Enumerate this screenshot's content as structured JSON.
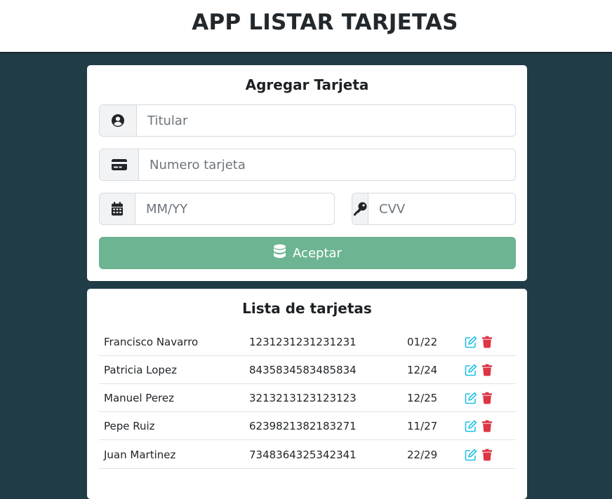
{
  "header": {
    "title": "APP LISTAR TARJETAS"
  },
  "form": {
    "title": "Agregar Tarjeta",
    "holder": {
      "placeholder": "Titular",
      "icon": "user-circle-icon"
    },
    "number": {
      "placeholder": "Numero tarjeta",
      "icon": "credit-card-icon"
    },
    "expiry": {
      "placeholder": "MM/YY",
      "icon": "calendar-icon"
    },
    "cvv": {
      "placeholder": "CVV",
      "icon": "key-icon"
    },
    "submit": {
      "label": "Aceptar",
      "icon": "database-icon",
      "color": "#6db592"
    }
  },
  "list": {
    "title": "Lista de tarjetas",
    "rows": [
      {
        "name": "Francisco Navarro",
        "number": "1231231231231231",
        "expiry": "01/22"
      },
      {
        "name": "Patricia Lopez",
        "number": "8435834583485834",
        "expiry": "12/24"
      },
      {
        "name": "Manuel Perez",
        "number": "3213213123123123",
        "expiry": "12/25"
      },
      {
        "name": "Pepe Ruiz",
        "number": "6239821382183271",
        "expiry": "11/27"
      },
      {
        "name": "Juan Martinez",
        "number": "7348364325342341",
        "expiry": "22/29"
      }
    ],
    "edit_icon_color": "#1fc0e6",
    "delete_icon_color": "#dc3545"
  },
  "colors": {
    "background": "#203c47",
    "accent": "#6db592"
  }
}
